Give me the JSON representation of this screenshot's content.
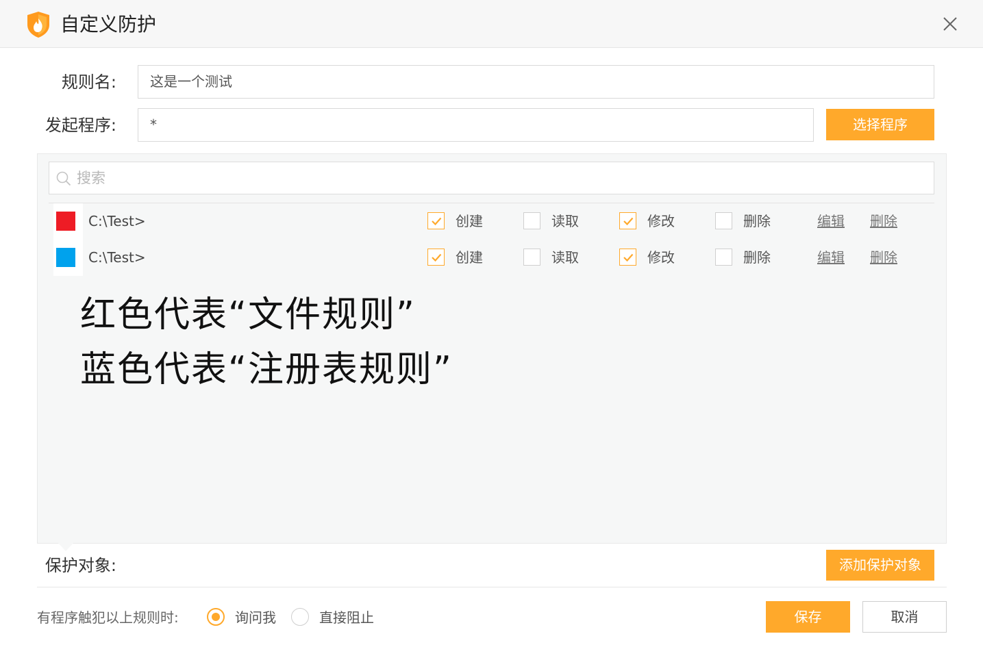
{
  "window": {
    "title": "自定义防护",
    "accent_color": "#ffa92b",
    "logo_icon": "shield-flame-icon",
    "close_icon": "close-icon"
  },
  "form": {
    "rule_name_label": "规则名:",
    "rule_name_value": "这是一个测试",
    "program_label": "发起程序:",
    "program_value": "*",
    "select_program_button": "选择程序"
  },
  "panel": {
    "search_placeholder": "搜索",
    "rows": [
      {
        "color": "#ee1c25",
        "path": "C:\\Test>",
        "create_label": "创建",
        "create_checked": true,
        "read_label": "读取",
        "read_checked": false,
        "modify_label": "修改",
        "modify_checked": true,
        "delete_label": "删除",
        "delete_checked": false,
        "edit_link": "编辑",
        "remove_link": "删除"
      },
      {
        "color": "#00a2ed",
        "path": "C:\\Test>",
        "create_label": "创建",
        "create_checked": true,
        "read_label": "读取",
        "read_checked": false,
        "modify_label": "修改",
        "modify_checked": true,
        "delete_label": "删除",
        "delete_checked": false,
        "edit_link": "编辑",
        "remove_link": "删除"
      }
    ],
    "annotations": [
      "红色代表“文件规则”",
      "蓝色代表“注册表规则”"
    ]
  },
  "protect": {
    "label": "保护对象:",
    "add_button": "添加保护对象"
  },
  "footer": {
    "trigger_text": "有程序触犯以上规则时:",
    "options": [
      {
        "label": "询问我",
        "selected": true
      },
      {
        "label": "直接阻止",
        "selected": false
      }
    ],
    "save_button": "保存",
    "cancel_button": "取消"
  }
}
